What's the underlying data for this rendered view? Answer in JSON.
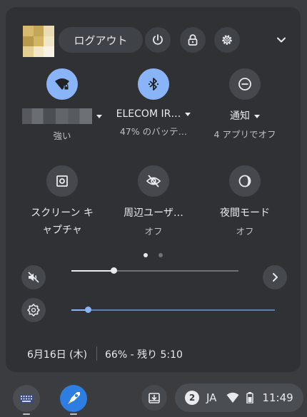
{
  "header": {
    "logout_label": "ログアウト",
    "avatar_colors": [
      "#d7ba6e",
      "#c5a75a",
      "#e9dcb5",
      "#b89a4c",
      "#d2b664",
      "#efe6c8",
      "#e4cf92",
      "#f1e8c9",
      "#f7f2e3"
    ]
  },
  "tiles": [
    {
      "id": "network",
      "label_redacted": true,
      "sub": "強い",
      "icon": "wifi-lock-icon",
      "active": true,
      "has_menu": true
    },
    {
      "id": "bluetooth",
      "label": "ELECOM IR…",
      "sub": "47% のバッテ…",
      "icon": "bluetooth-icon",
      "active": true,
      "has_menu": true
    },
    {
      "id": "notifications",
      "label": "通知",
      "sub": "4 アプリでオフ",
      "icon": "do-not-disturb-icon",
      "active": false,
      "has_menu": true
    },
    {
      "id": "screen-capture",
      "label_line1": "スクリーン キ",
      "label_line2": "ャプチャ",
      "icon": "screen-capture-icon",
      "active": false
    },
    {
      "id": "privacy",
      "label": "周辺ユーザ…",
      "sub": "オフ",
      "icon": "eye-off-icon",
      "active": false
    },
    {
      "id": "night-mode",
      "label": "夜間モード",
      "sub": "オフ",
      "icon": "night-mode-icon",
      "active": false
    }
  ],
  "pagination": {
    "pages": 2,
    "current": 1
  },
  "volume": {
    "level": 0.25,
    "muted": true
  },
  "brightness": {
    "level": 0.08
  },
  "footer": {
    "date": "6月16日 (木)",
    "battery": "66% - 残り 5:10"
  },
  "shelf": {
    "notification_count": "2",
    "ime": "JA",
    "time": "11:49",
    "apps": [
      "launcher-icon",
      "app-rocket-icon"
    ]
  },
  "colors": {
    "accent": "#8ab4f8",
    "panel": "#2f3134",
    "shelf": "#3a3c40"
  }
}
